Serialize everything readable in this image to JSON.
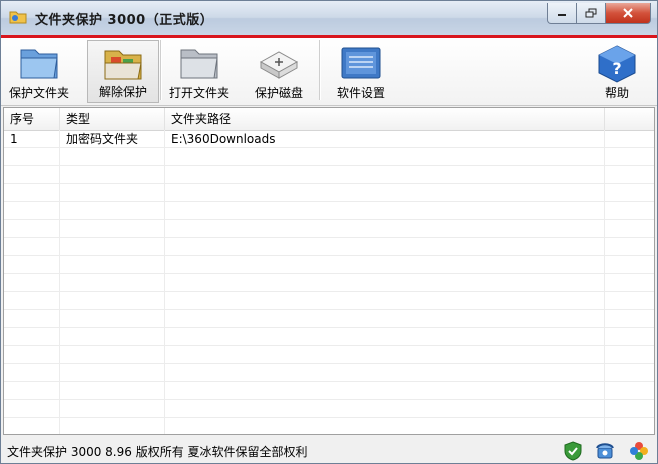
{
  "window": {
    "title": "文件夹保护 3000（正式版）"
  },
  "toolbar": {
    "protect_folder": "保护文件夹",
    "unprotect": "解除保护",
    "open_folder": "打开文件夹",
    "protect_disk": "保护磁盘",
    "settings": "软件设置",
    "help": "帮助"
  },
  "table": {
    "columns": [
      "序号",
      "类型",
      "文件夹路径",
      ""
    ],
    "rows": [
      {
        "index": "1",
        "type": "加密码文件夹",
        "path": "E:\\360Downloads"
      }
    ]
  },
  "status": {
    "text": "文件夹保护 3000 8.96 版权所有 夏冰软件保留全部权利"
  },
  "colors": {
    "accent_red": "#d9161d",
    "titlebar": "#c9d6e6"
  }
}
